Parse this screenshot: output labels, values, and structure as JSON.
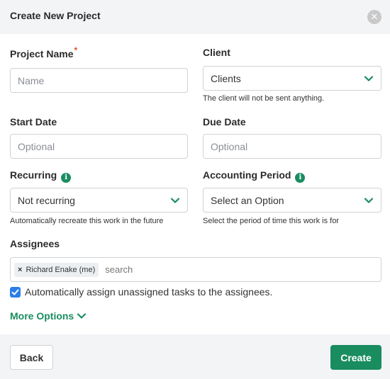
{
  "dialog": {
    "title": "Create New Project"
  },
  "fields": {
    "project_name": {
      "label": "Project Name",
      "required_mark": "*",
      "placeholder": "Name",
      "value": ""
    },
    "client": {
      "label": "Client",
      "selected": "Clients",
      "help": "The client will not be sent anything."
    },
    "start_date": {
      "label": "Start Date",
      "placeholder": "Optional",
      "value": ""
    },
    "due_date": {
      "label": "Due Date",
      "placeholder": "Optional",
      "value": ""
    },
    "recurring": {
      "label": "Recurring",
      "info_icon": "i",
      "selected": "Not recurring",
      "help": "Automatically recreate this work in the future"
    },
    "accounting_period": {
      "label": "Accounting Period",
      "info_icon": "i",
      "selected": "Select an Option",
      "help": "Select the period of time this work is for"
    },
    "assignees": {
      "label": "Assignees",
      "chips": [
        "Richard Enake (me)"
      ],
      "chip_remove": "×",
      "search_placeholder": "search"
    },
    "auto_assign": {
      "label": "Automatically assign unassigned tasks to the assignees.",
      "checked": true
    }
  },
  "more_options": "More Options",
  "footer": {
    "back_label": "Back",
    "create_label": "Create"
  },
  "colors": {
    "accent_green": "#1a8d60",
    "required_red": "#e0532b",
    "checkbox_blue": "#2b7de9",
    "header_bg": "#f3f4f6"
  },
  "icons": {
    "close": "close-icon",
    "chevron": "chevron-down-icon",
    "info": "info-icon",
    "check": "checkmark-icon"
  }
}
